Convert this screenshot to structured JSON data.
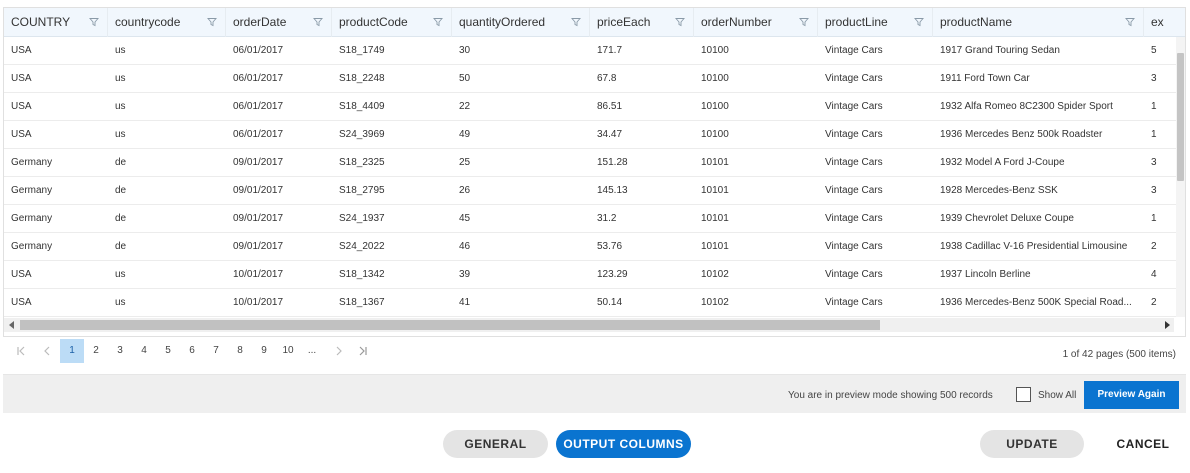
{
  "columns": [
    {
      "label": "COUNTRY",
      "width": 104
    },
    {
      "label": "countrycode",
      "width": 118
    },
    {
      "label": "orderDate",
      "width": 106
    },
    {
      "label": "productCode",
      "width": 120
    },
    {
      "label": "quantityOrdered",
      "width": 138
    },
    {
      "label": "priceEach",
      "width": 104
    },
    {
      "label": "orderNumber",
      "width": 124
    },
    {
      "label": "productLine",
      "width": 115
    },
    {
      "label": "productName",
      "width": 211
    },
    {
      "label": "ex",
      "width": 60
    }
  ],
  "rows": [
    [
      "USA",
      "us",
      "06/01/2017",
      "S18_1749",
      "30",
      "171.7",
      "10100",
      "Vintage Cars",
      "1917 Grand Touring Sedan",
      "5"
    ],
    [
      "USA",
      "us",
      "06/01/2017",
      "S18_2248",
      "50",
      "67.8",
      "10100",
      "Vintage Cars",
      "1911 Ford Town Car",
      "3"
    ],
    [
      "USA",
      "us",
      "06/01/2017",
      "S18_4409",
      "22",
      "86.51",
      "10100",
      "Vintage Cars",
      "1932 Alfa Romeo 8C2300 Spider Sport",
      "1"
    ],
    [
      "USA",
      "us",
      "06/01/2017",
      "S24_3969",
      "49",
      "34.47",
      "10100",
      "Vintage Cars",
      "1936 Mercedes Benz 500k Roadster",
      "1"
    ],
    [
      "Germany",
      "de",
      "09/01/2017",
      "S18_2325",
      "25",
      "151.28",
      "10101",
      "Vintage Cars",
      "1932 Model A Ford J-Coupe",
      "3"
    ],
    [
      "Germany",
      "de",
      "09/01/2017",
      "S18_2795",
      "26",
      "145.13",
      "10101",
      "Vintage Cars",
      "1928 Mercedes-Benz SSK",
      "3"
    ],
    [
      "Germany",
      "de",
      "09/01/2017",
      "S24_1937",
      "45",
      "31.2",
      "10101",
      "Vintage Cars",
      "1939 Chevrolet Deluxe Coupe",
      "1"
    ],
    [
      "Germany",
      "de",
      "09/01/2017",
      "S24_2022",
      "46",
      "53.76",
      "10101",
      "Vintage Cars",
      "1938 Cadillac V-16 Presidential Limousine",
      "2"
    ],
    [
      "USA",
      "us",
      "10/01/2017",
      "S18_1342",
      "39",
      "123.29",
      "10102",
      "Vintage Cars",
      "1937 Lincoln Berline",
      "4"
    ],
    [
      "USA",
      "us",
      "10/01/2017",
      "S18_1367",
      "41",
      "50.14",
      "10102",
      "Vintage Cars",
      "1936 Mercedes-Benz 500K Special Road...",
      "2"
    ]
  ],
  "pager": {
    "first": "K",
    "prev": "‹",
    "pages": [
      "1",
      "2",
      "3",
      "4",
      "5",
      "6",
      "7",
      "8",
      "9",
      "10",
      "..."
    ],
    "next": "›",
    "last": "K",
    "info": "1 of 42 pages (500 items)"
  },
  "preview": {
    "text": "You are in preview mode showing 500 records",
    "show_all": "Show All",
    "button": "Preview Again"
  },
  "footer": {
    "general": "GENERAL",
    "output_columns": "OUTPUT COLUMNS",
    "update": "UPDATE",
    "cancel": "CANCEL"
  },
  "colors": {
    "primary": "#0a74d0",
    "header_bg": "#f1f7fd",
    "active_page": "#bcdcf6"
  },
  "icons": {
    "column_filter": "filter-icon"
  }
}
